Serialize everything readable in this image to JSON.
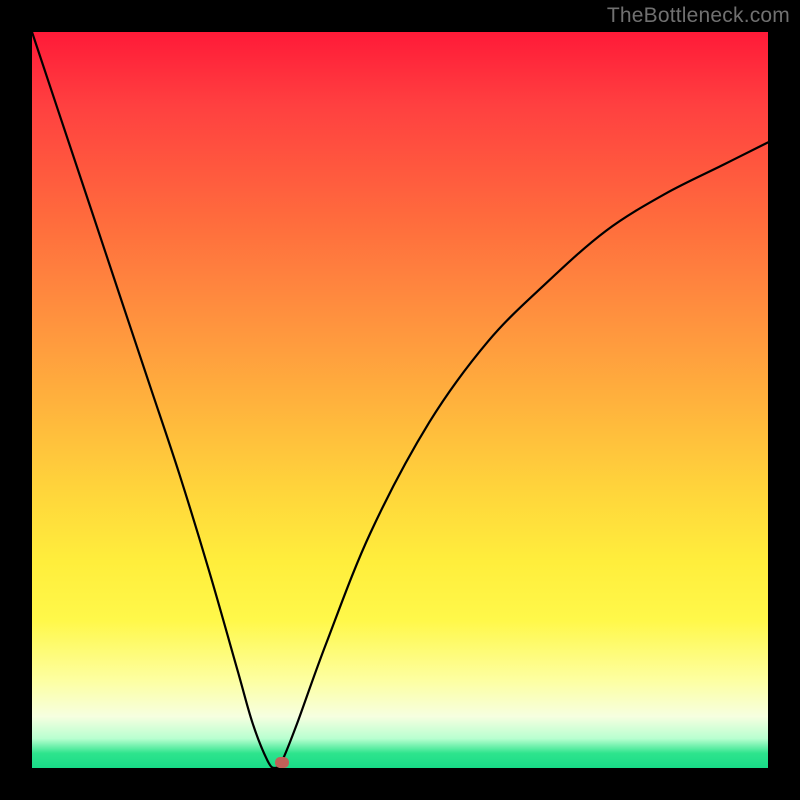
{
  "watermark": "TheBottleneck.com",
  "colors": {
    "frame": "#000000",
    "curve": "#000000",
    "marker": "#c06058",
    "gradient_stops": [
      "#ff1a38",
      "#ff4040",
      "#ff6a3d",
      "#ff8f3e",
      "#ffb13d",
      "#ffd43b",
      "#ffee3c",
      "#fff84a",
      "#fdffa0",
      "#f6ffe0",
      "#b8ffd0",
      "#2ee48d",
      "#18db87"
    ]
  },
  "chart_data": {
    "type": "line",
    "title": "",
    "xlabel": "",
    "ylabel": "",
    "xlim": [
      0,
      100
    ],
    "ylim": [
      0,
      100
    ],
    "note": "Axes unlabeled; values are normalized 0-100 estimated from pixel positions. y=0 at bottom (green), y=100 at top (red). Curve is a V-shaped bottleneck dip reaching ~0 near x≈33.",
    "series": [
      {
        "name": "bottleneck-curve",
        "x": [
          0,
          4,
          8,
          12,
          16,
          20,
          24,
          28,
          30,
          32,
          33,
          34,
          36,
          40,
          46,
          54,
          62,
          70,
          78,
          86,
          94,
          100
        ],
        "y": [
          100,
          88,
          76,
          64,
          52,
          40,
          27,
          13,
          6,
          1,
          0,
          1,
          6,
          17,
          32,
          47,
          58,
          66,
          73,
          78,
          82,
          85
        ]
      }
    ],
    "marker": {
      "x": 34,
      "y": 0.8,
      "label": "optimal-point"
    }
  }
}
